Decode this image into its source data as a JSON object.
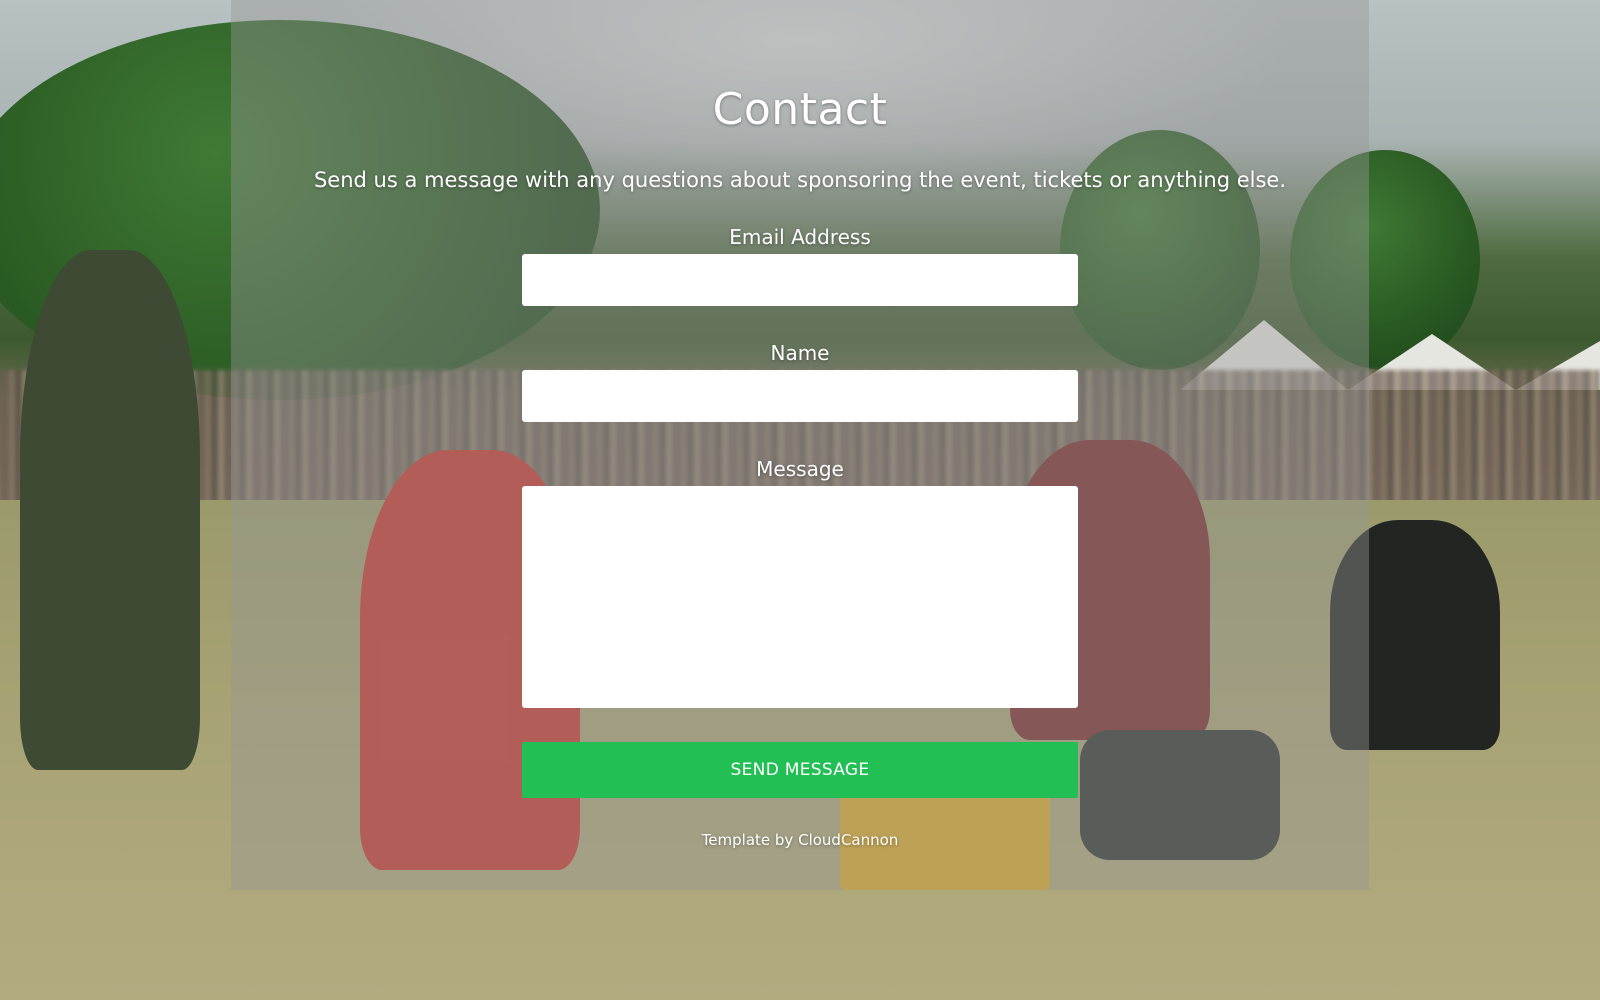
{
  "page": {
    "title": "Contact",
    "intro": "Send us a message with any questions about sponsoring the event, tickets or anything else."
  },
  "form": {
    "email_label": "Email Address",
    "email_value": "",
    "name_label": "Name",
    "name_value": "",
    "message_label": "Message",
    "message_value": "",
    "submit_label": "SEND MESSAGE"
  },
  "footer": {
    "credit_prefix": "Template by",
    "credit_link": "CloudCannon"
  },
  "colors": {
    "accent": "#22bf55",
    "panel_overlay": "rgba(150,150,150,0.42)",
    "text": "#ffffff"
  }
}
